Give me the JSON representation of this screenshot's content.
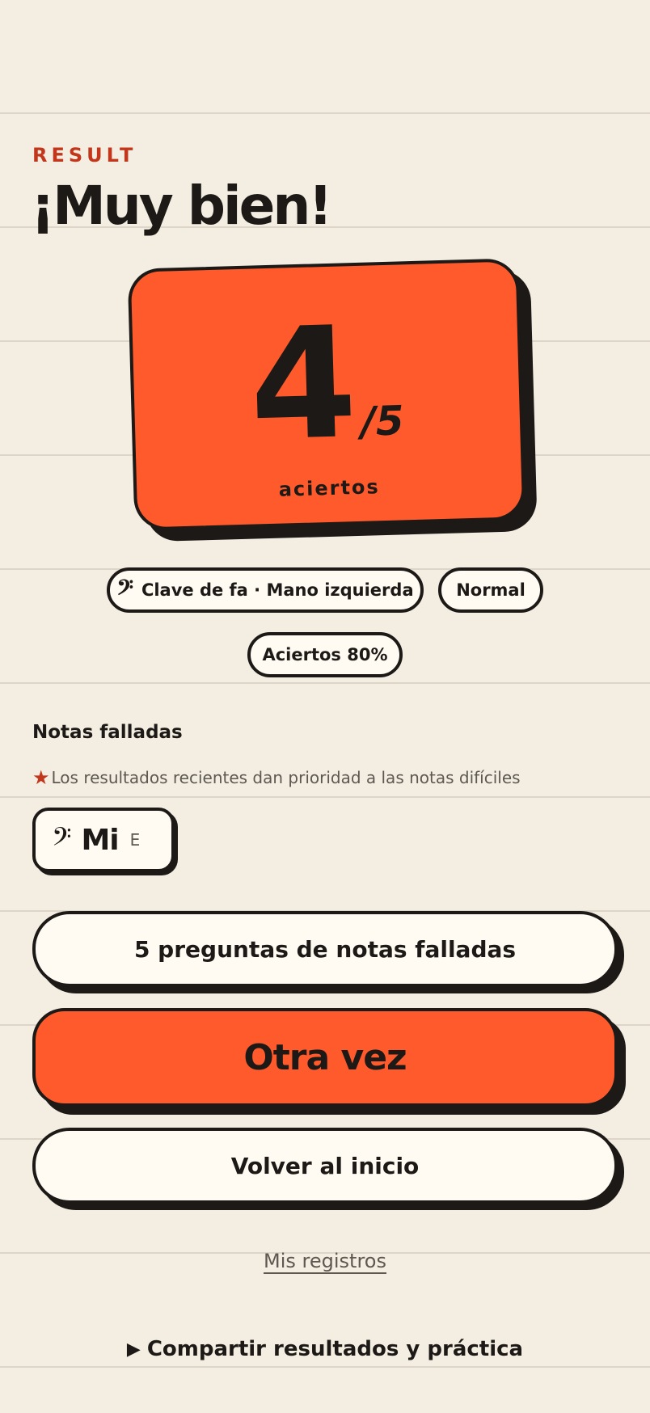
{
  "header": {
    "eyebrow": "RESULT",
    "title": "¡Muy bien!"
  },
  "score": {
    "correct": "4",
    "total": "/5",
    "caption": "aciertos"
  },
  "chips": {
    "clef_icon": "𝄢",
    "clef_label": "Clave de fa · Mano izquierda",
    "difficulty": "Normal",
    "accuracy": "Aciertos 80%"
  },
  "missed": {
    "title": "Notas falladas",
    "star_icon": "★",
    "hint": "Los resultados recientes dan prioridad a las notas difíciles",
    "notes": [
      {
        "clef_icon": "𝄢",
        "name": "Mi",
        "letter": "E"
      }
    ]
  },
  "actions": {
    "practice_missed": "5 preguntas de notas falladas",
    "retry": "Otra vez",
    "home": "Volver al inicio",
    "records": "Mis registros",
    "share_icon": "▶",
    "share": "Compartir resultados y práctica"
  },
  "colors": {
    "accent": "#ff5a2c",
    "eyebrow": "#c2361b",
    "ink": "#1c1916",
    "background": "#f4eee2",
    "card": "#fffbf3"
  }
}
